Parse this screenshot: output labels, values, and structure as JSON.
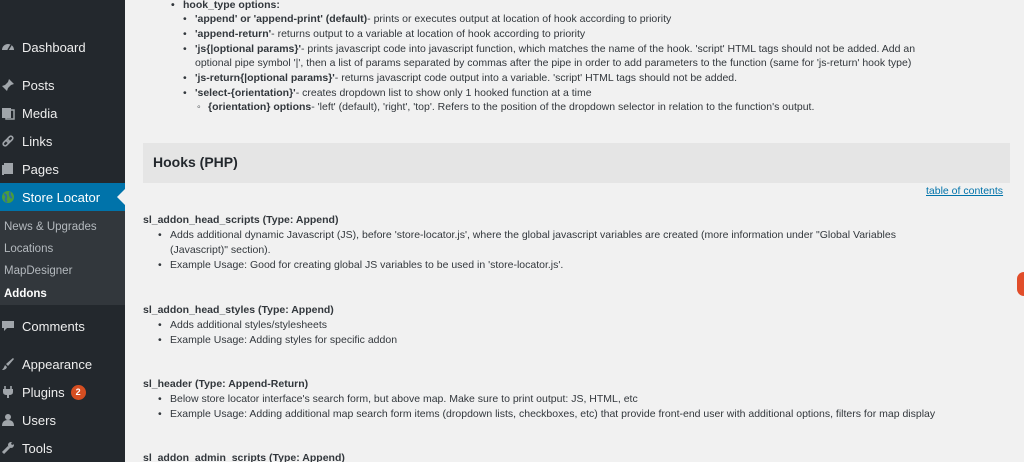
{
  "sidebar": {
    "items": [
      {
        "label": "Dashboard",
        "icon": "dashboard-icon"
      },
      {
        "label": "Posts",
        "icon": "pin-icon"
      },
      {
        "label": "Media",
        "icon": "media-icon"
      },
      {
        "label": "Links",
        "icon": "link-icon"
      },
      {
        "label": "Pages",
        "icon": "pages-icon"
      },
      {
        "label": "Store Locator",
        "icon": "globe-icon"
      },
      {
        "label": "Comments",
        "icon": "comment-icon"
      },
      {
        "label": "Appearance",
        "icon": "brush-icon"
      },
      {
        "label": "Plugins",
        "icon": "plugin-icon",
        "badge": "2"
      },
      {
        "label": "Users",
        "icon": "user-icon"
      },
      {
        "label": "Tools",
        "icon": "wrench-icon"
      }
    ],
    "submenu": [
      "News & Upgrades",
      "Locations",
      "MapDesigner",
      "Addons"
    ],
    "active_color": "#0073aa",
    "bg_color": "#23282d"
  },
  "doc": {
    "hook_type_heading": "hook_type options:",
    "opt_append_b": "'append' or 'append-print' (default)",
    "opt_append_t": "- prints or executes output at location of hook according to priority",
    "opt_return_b": "'append-return'",
    "opt_return_t": "- returns output to a variable at location of hook according to priority",
    "opt_js_b": "'js{|optional params}'",
    "opt_js_t1": "- prints javascript code into javascript function, which matches the name of the hook. 'script' HTML tags should not be added. Add an",
    "opt_js_t2": "optional pipe symbol '|', then a list of params separated by commas after the pipe in order to add parameters to the function (same for 'js-return' hook type)",
    "opt_jsret_b": "'js-return{|optional params}'",
    "opt_jsret_t": "- returns javascript code output into a variable. 'script' HTML tags should not be added.",
    "opt_select_b": "'select-{orientation}'",
    "opt_select_t": "- creates dropdown list to show only 1 hooked function at a time",
    "opt_orient_b": "{orientation} options",
    "opt_orient_t": "- 'left' (default), 'right', 'top'. Refers to the position of the dropdown selector in relation to the function's output.",
    "section_title": "Hooks (PHP)",
    "toc_link": "table of contents",
    "hooks": [
      {
        "title": "sl_addon_head_scripts (Type: Append)",
        "bullets": [
          "Adds additional dynamic Javascript (JS), before 'store-locator.js', where the global javascript variables are created (more information under \"Global Variables",
          "(Javascript)\" section).",
          "Example Usage: Good for creating global JS variables to be used in 'store-locator.js'."
        ]
      },
      {
        "title": "sl_addon_head_styles (Type: Append)",
        "bullets": [
          "Adds additional styles/stylesheets",
          "Example Usage: Adding styles for specific addon"
        ]
      },
      {
        "title": "sl_header (Type: Append-Return)",
        "bullets": [
          "Below store locator interface's search form, but above map. Make sure to print output: JS, HTML, etc",
          "Example Usage: Adding additional map search form items (dropdown lists, checkboxes, etc) that provide front-end user with additional options, filters for map display"
        ]
      },
      {
        "title": "sl_addon_admin_scripts (Type: Append)",
        "bullets": []
      }
    ]
  }
}
